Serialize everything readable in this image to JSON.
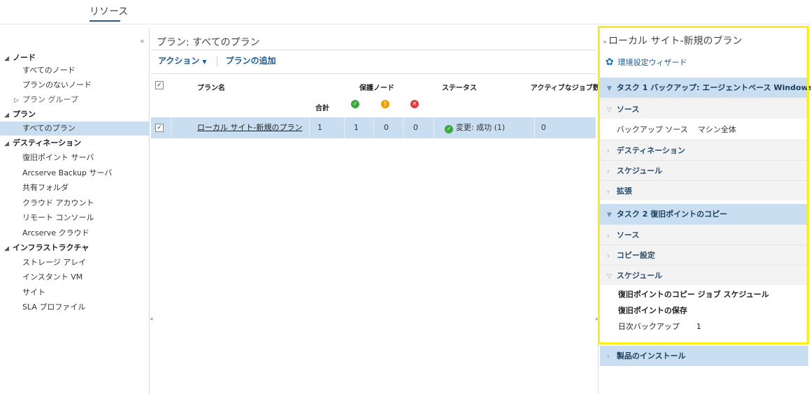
{
  "top_tab": {
    "label": "リソース"
  },
  "sidebar": {
    "collapse_icon": "double-chevron-left-icon",
    "categories": [
      {
        "label": "ノード",
        "items": [
          "すべてのノード",
          "プランのないノード",
          "プラン グループ"
        ]
      },
      {
        "label": "プラン",
        "items": [
          "すべてのプラン"
        ]
      },
      {
        "label": "デスティネーション",
        "items": [
          "復旧ポイント サーバ",
          "Arcserve Backup サーバ",
          "共有フォルダ",
          "クラウド アカウント",
          "リモート コンソール",
          "Arcserve クラウド"
        ]
      },
      {
        "label": "インフラストラクチャ",
        "items": [
          "ストレージ アレイ",
          "インスタント VM",
          "サイト",
          "SLA プロファイル"
        ]
      }
    ],
    "selected_item": "すべてのプラン"
  },
  "center": {
    "title": "プラン: すべてのプラン",
    "toolbar": {
      "action_label": "アクション",
      "add_plan_label": "プランの追加"
    },
    "table": {
      "headers": {
        "plan_name": "プラン名",
        "protected_nodes": "保護ノード",
        "status": "ステータス",
        "active_jobs": "アクティブなジョブ数",
        "total": "合計"
      },
      "rows": [
        {
          "checked": true,
          "name": "ローカル サイト-新規のプラン",
          "total": "1",
          "ok": "1",
          "warn": "0",
          "error": "0",
          "status": "変更: 成功 (1)",
          "active_jobs": "0"
        }
      ]
    }
  },
  "right_panel": {
    "title": "ローカル サイト-新規のプラン",
    "wizard_label": "環境設定ウィザード",
    "task1": {
      "label": "タスク 1 バックアップ: エージェントベース Windows",
      "source_label": "ソース",
      "backup_source_key": "バックアップ ソース",
      "backup_source_value": "マシン全体",
      "destination_label": "デスティネーション",
      "schedule_label": "スケジュール",
      "advanced_label": "拡張"
    },
    "task2": {
      "label": "タスク 2 復旧ポイントのコピー",
      "source_label": "ソース",
      "copy_settings_label": "コピー設定",
      "schedule_label": "スケジュール",
      "copy_job_schedule": "復旧ポイントのコピー ジョブ スケジュール",
      "retention_label": "復旧ポイントの保存",
      "daily_backup_key": "日次バックアップ",
      "daily_backup_value": "1"
    },
    "install_label": "製品のインストール"
  },
  "colors": {
    "selection": "#c9def0",
    "link": "#1d5b94",
    "ok": "#3aa83a",
    "warn": "#f0a000",
    "error": "#e03c3c",
    "highlight": "#f7ee1b"
  }
}
